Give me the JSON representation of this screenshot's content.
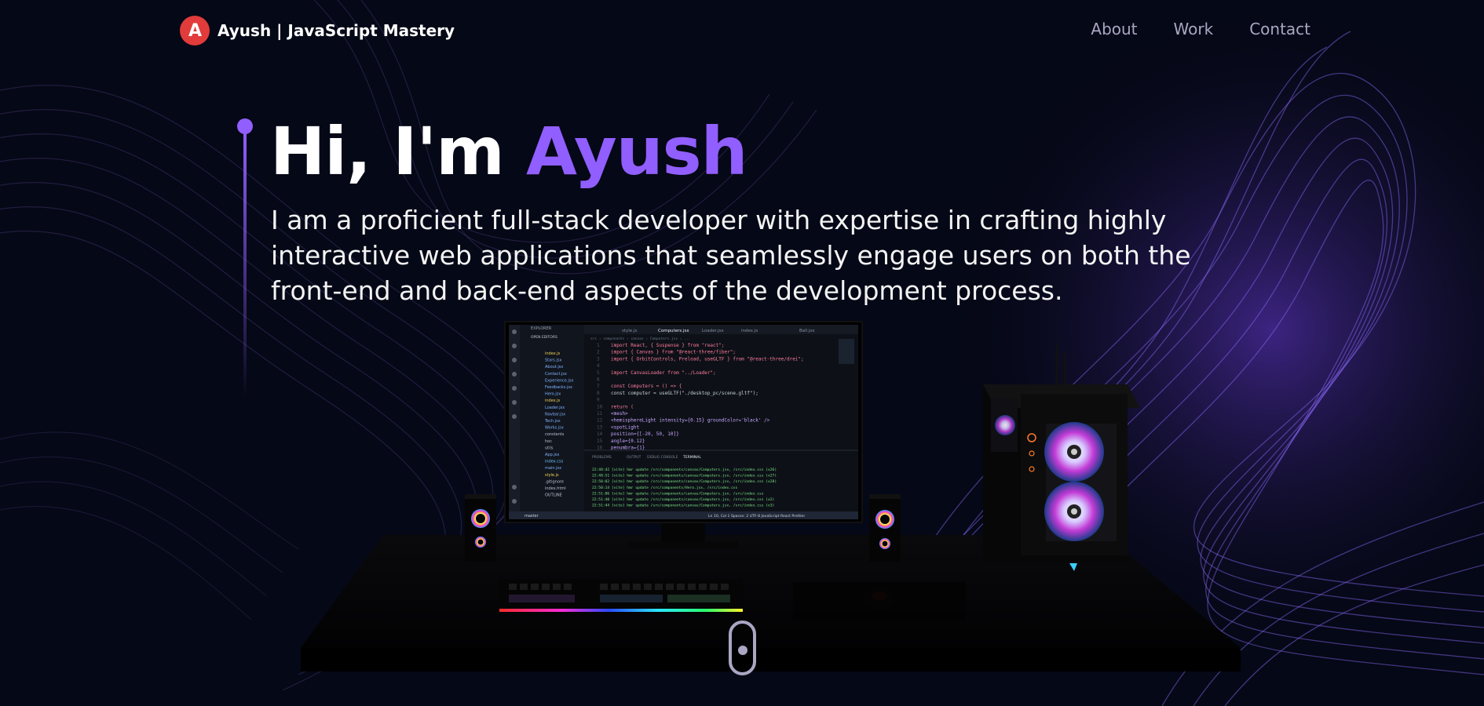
{
  "navbar": {
    "logo_mark": "A",
    "logo_name": "Ayush",
    "logo_sep": " | ",
    "logo_tagline": "JavaScript Mastery",
    "links": [
      {
        "label": "About"
      },
      {
        "label": "Work"
      },
      {
        "label": "Contact"
      }
    ]
  },
  "hero": {
    "greeting": "Hi, I'm ",
    "name": "Ayush",
    "description": "I am a proficient full-stack developer with expertise in crafting highly interactive web applications that seamlessly engage users on both the front-end and back-end aspects of the development process."
  },
  "editor": {
    "sidebar_title": "EXPLORER",
    "sidebar_open_editors": "OPEN EDITORS",
    "tabs": [
      "style.js",
      "Computers.jsx",
      "Loader.jsx",
      "index.js",
      "Ball.jsx"
    ],
    "files": [
      "index.js",
      "Stars.jsx",
      "About.jsx",
      "Contact.jsx",
      "Experience.jsx",
      "Feedbacks.jsx",
      "Hero.jsx",
      "index.js",
      "Loader.jsx",
      "Navbar.jsx",
      "Tech.jsx",
      "Works.jsx",
      "constants",
      "hoc",
      "utils",
      "App.jsx",
      "index.css",
      "main.jsx",
      "style.js",
      ".gitignore",
      "index.html",
      "OUTLINE"
    ],
    "code": [
      "import React, { Suspense } from \"react\";",
      "import { Canvas } from \"@react-three/fiber\";",
      "import { OrbitControls, Preload, useGLTF } from \"@react-three/drei\";",
      "",
      "import CanvasLoader from \"../Loader\";",
      "",
      "const Computers = () => {",
      "  const computer = useGLTF(\"./desktop_pc/scene.gltf\");",
      "",
      "  return (",
      "    <mesh>",
      "      <hemisphereLight intensity={0.15} groundColor='black' />",
      "      <spotLight",
      "        position={[-20, 50, 10]}",
      "        angle={0.12}",
      "        penumbra={1}"
    ],
    "panel_tabs": [
      "PROBLEMS",
      "OUTPUT",
      "DEBUG CONSOLE",
      "TERMINAL"
    ],
    "terminal": [
      "22:48:42 [vite] hmr update /src/components/canvas/Computers.jsx, /src/index.css (x26)",
      "22:48:51 [vite] hmr update /src/components/canvas/Computers.jsx, /src/index.css (x27)",
      "22:50:02 [vite] hmr update /src/components/canvas/Computers.jsx, /src/index.css (x28)",
      "22:50:14 [vite] hmr update /src/components/Hero.jsx, /src/index.css",
      "22:51:06 [vite] hmr update /src/components/canvas/Computers.jsx, /src/index.css",
      "22:51:40 [vite] hmr update /src/components/canvas/Computers.jsx, /src/index.css (x2)",
      "22:51:44 [vite] hmr update /src/components/canvas/Computers.jsx, /src/index.css (x3)"
    ],
    "status_left": "master",
    "status_right": "Ln 10, Col 1   Spaces: 2   UTF-8   JavaScript React   Prettier"
  },
  "colors": {
    "background": "#050816",
    "accent": "#915eff",
    "secondary_text": "#aaa6c3",
    "logo": "#e13b3b"
  },
  "scroll_indicator": {
    "icon": "mouse-scroll-icon"
  }
}
